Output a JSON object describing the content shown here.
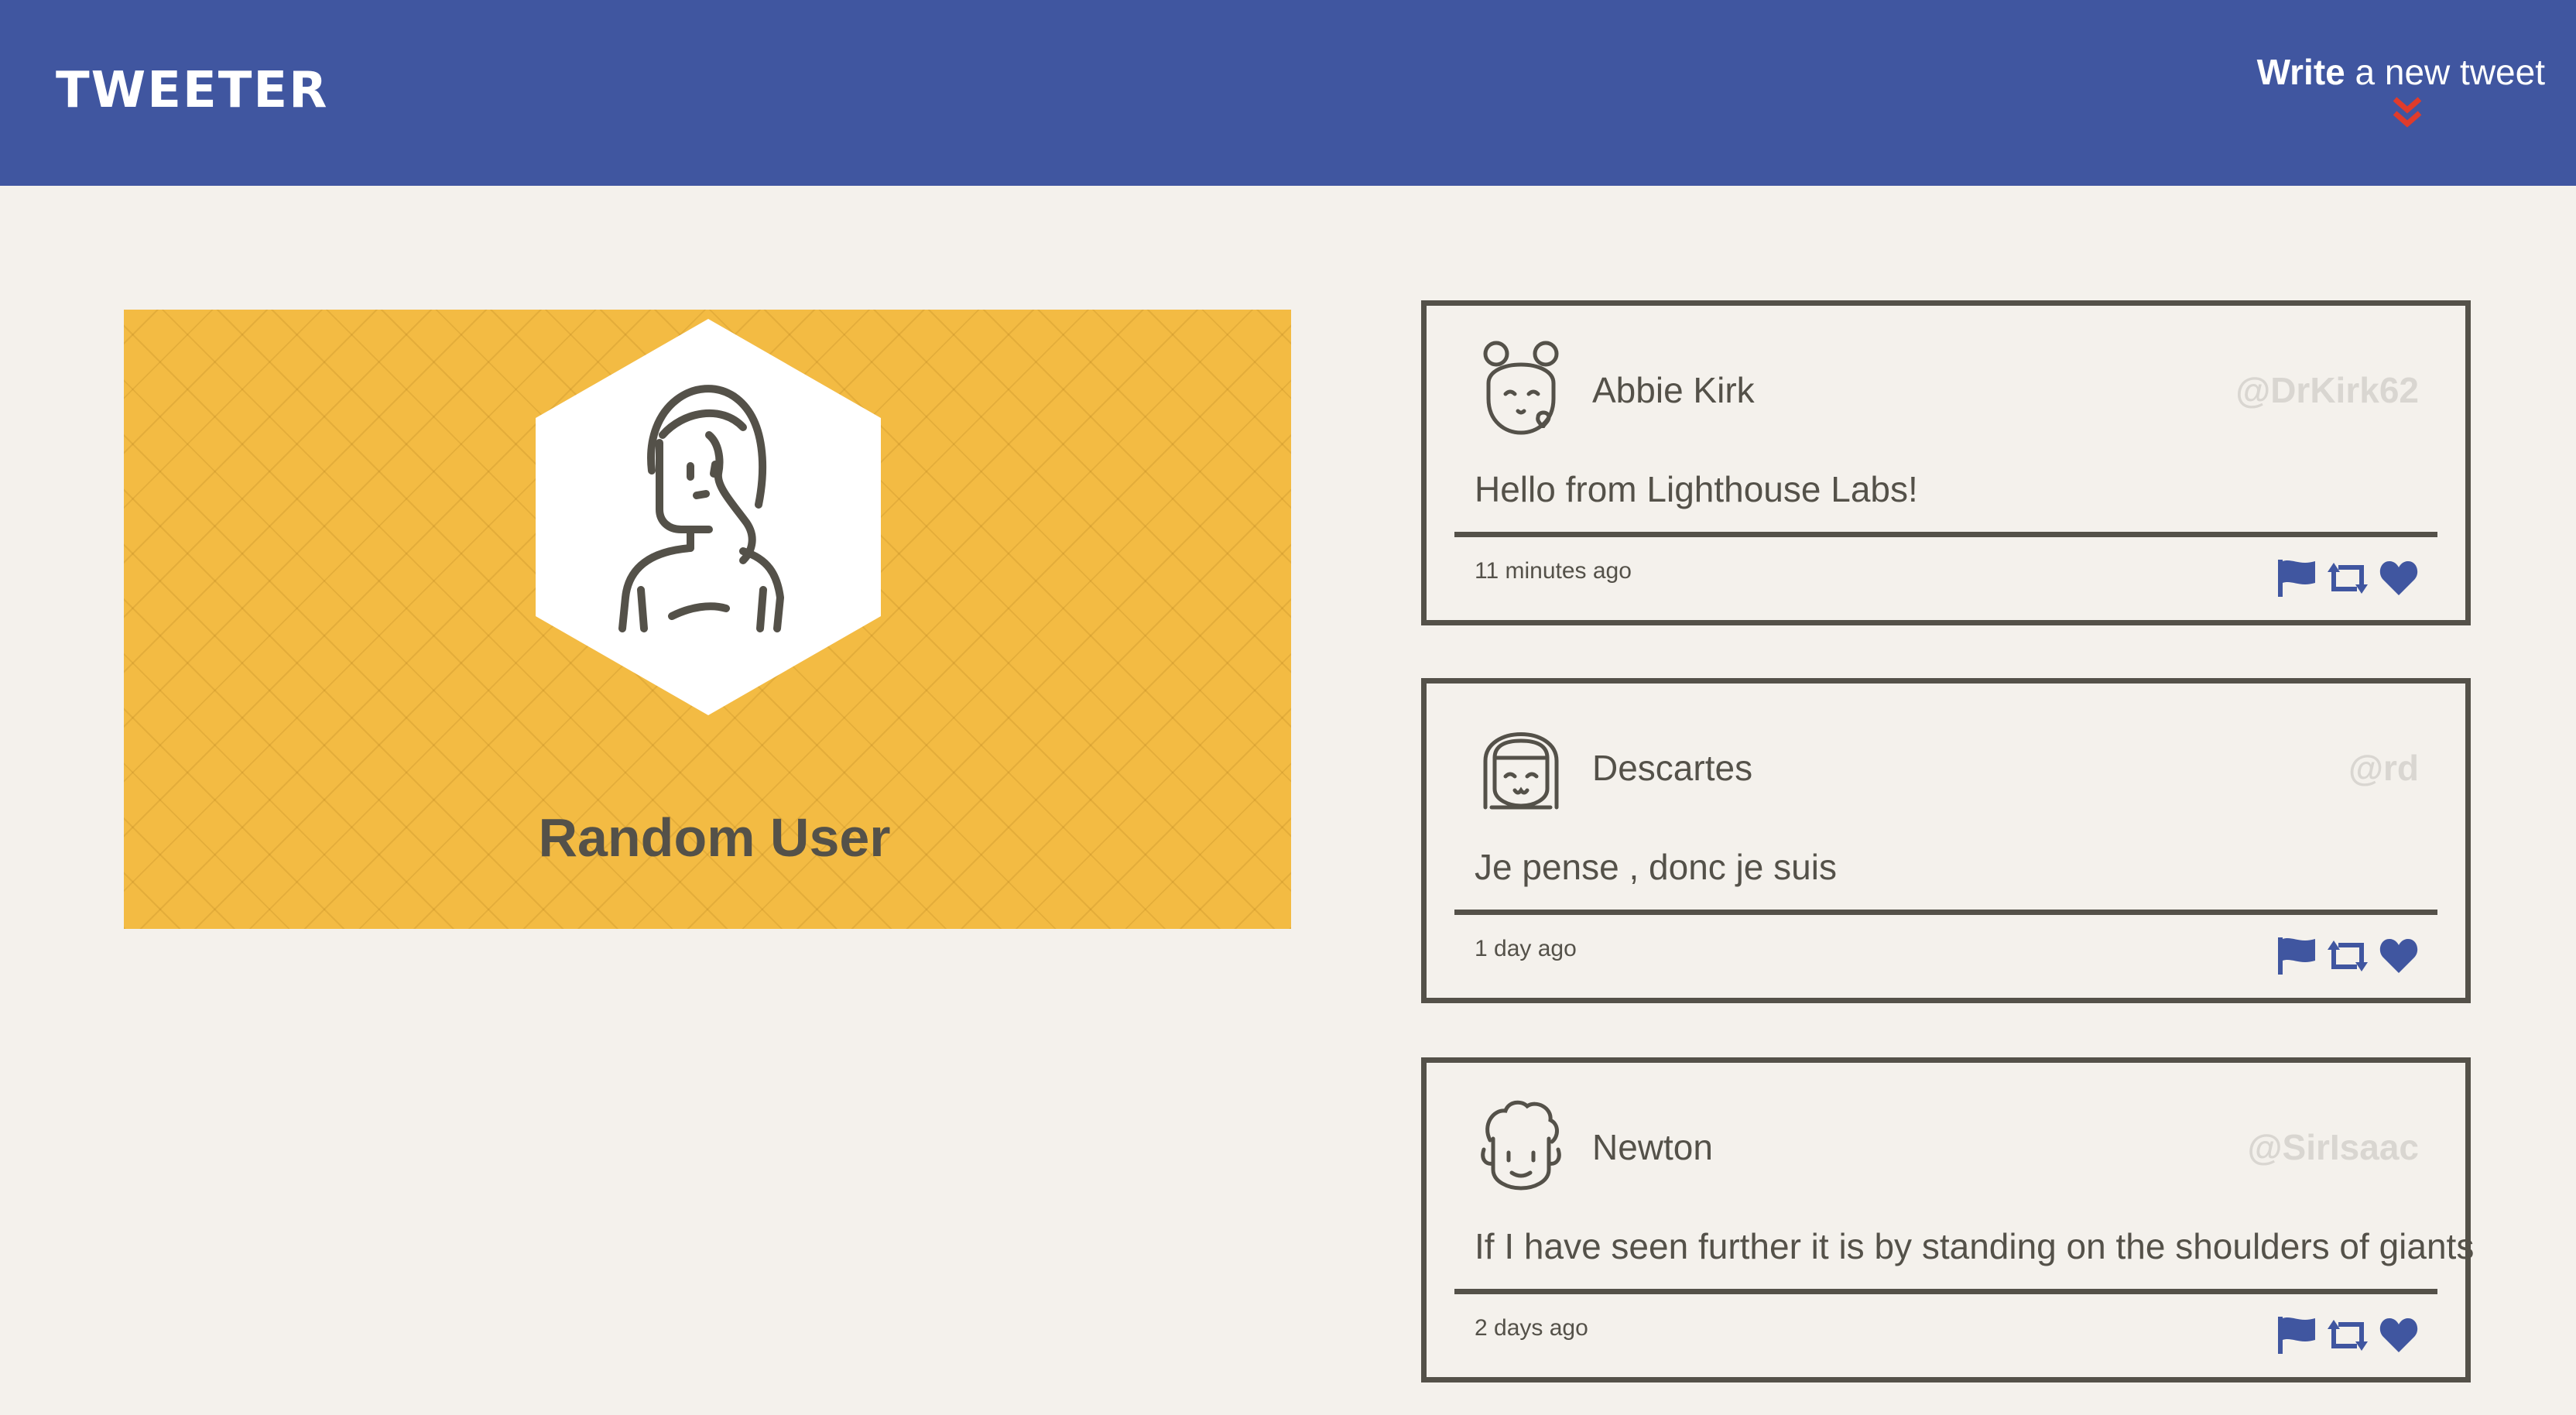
{
  "nav": {
    "brand": "TWEETER",
    "compose_bold": "Write",
    "compose_rest": " a new tweet"
  },
  "profile": {
    "name": "Random User"
  },
  "tweets": [
    {
      "name": "Abbie Kirk",
      "handle": "@DrKirk62",
      "text": "Hello from Lighthouse Labs!",
      "time": "11 minutes ago"
    },
    {
      "name": "Descartes",
      "handle": "@rd",
      "text": "Je pense , donc je suis",
      "time": "1 day ago"
    },
    {
      "name": "Newton",
      "handle": "@SirIsaac",
      "text": "If I have seen further it is by standing on the shoulders of giants",
      "time": "2 days ago"
    }
  ],
  "colors": {
    "nav": "#4056a0",
    "profile_bg": "#f3bb43",
    "page_bg": "#f4f1ec",
    "text": "#545149",
    "handle": "#d9d6d1",
    "action_icon": "#4056a0",
    "compose_arrow": "#e03b2b"
  },
  "icons": [
    "double-chevron-down-icon",
    "flag-icon",
    "retweet-icon",
    "heart-icon",
    "avatar-icon"
  ]
}
